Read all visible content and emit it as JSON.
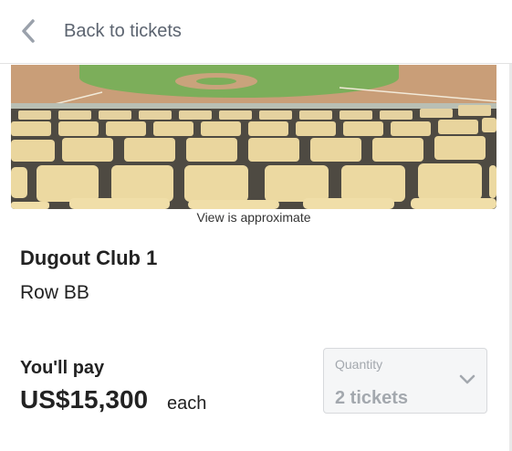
{
  "header": {
    "back_label": "Back to tickets"
  },
  "seat_view": {
    "caption": "View is approximate"
  },
  "listing": {
    "section": "Dugout Club 1",
    "row": "Row BB"
  },
  "pricing": {
    "pay_label": "You'll pay",
    "price": "US$15,300",
    "unit": "each"
  },
  "quantity": {
    "label": "Quantity",
    "selected": "2 tickets"
  },
  "colors": {
    "seat": "#e9d59a",
    "field_grass": "#7cae5a",
    "infield_dirt": "#c9a37c",
    "muted_text": "#a3a8ae"
  },
  "icons": {
    "back": "chevron-left-icon",
    "dropdown": "chevron-down-icon"
  }
}
